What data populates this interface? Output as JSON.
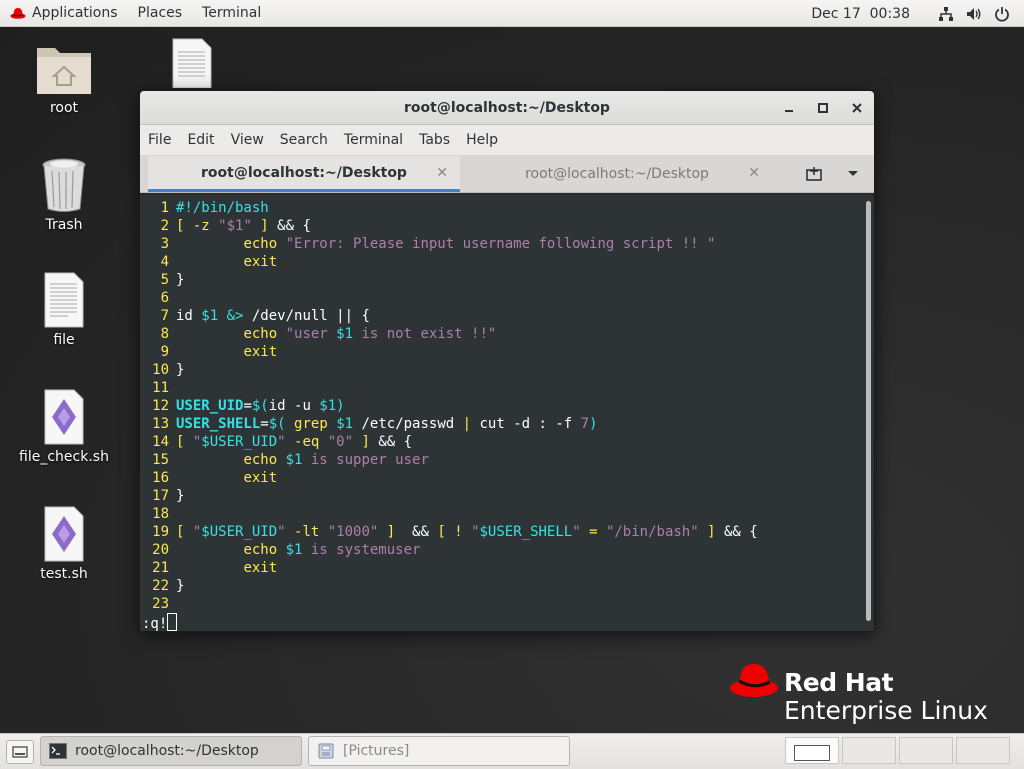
{
  "topbar": {
    "applications": "Applications",
    "places": "Places",
    "terminal": "Terminal",
    "clock": "Dec 17  00:38",
    "icons": [
      "network-icon",
      "volume-icon",
      "power-icon"
    ]
  },
  "desktop_icons": [
    {
      "label": "root",
      "icon": "home-folder-icon"
    },
    {
      "label": "Trash",
      "icon": "trash-icon"
    },
    {
      "label": "file",
      "icon": "text-file-icon"
    },
    {
      "label": "file_check.sh",
      "icon": "script-file-icon"
    },
    {
      "label": "test.sh",
      "icon": "script-file-icon"
    }
  ],
  "window": {
    "title": "root@localhost:~/Desktop",
    "menu": [
      "File",
      "Edit",
      "View",
      "Search",
      "Terminal",
      "Tabs",
      "Help"
    ],
    "tabs": [
      {
        "label": "root@localhost:~/Desktop",
        "active": true
      },
      {
        "label": "root@localhost:~/Desktop",
        "active": false
      }
    ],
    "command_line": ":q!"
  },
  "code_lines": [
    {
      "n": "1",
      "segs": [
        {
          "t": "#!/bin/bash",
          "c": "c"
        }
      ]
    },
    {
      "n": "2",
      "segs": [
        {
          "t": "[ -z ",
          "c": "y"
        },
        {
          "t": "\"$1\"",
          "c": "p"
        },
        {
          "t": " ] ",
          "c": "y"
        },
        {
          "t": "&& {",
          "c": "w"
        }
      ]
    },
    {
      "n": "3",
      "segs": [
        {
          "t": "        ",
          "c": "w"
        },
        {
          "t": "echo",
          "c": "y"
        },
        {
          "t": " \"Error: Please input username following script !! \"",
          "c": "p"
        }
      ]
    },
    {
      "n": "4",
      "segs": [
        {
          "t": "        ",
          "c": "w"
        },
        {
          "t": "exit",
          "c": "y"
        }
      ]
    },
    {
      "n": "5",
      "segs": [
        {
          "t": "}",
          "c": "w"
        }
      ]
    },
    {
      "n": "6",
      "segs": []
    },
    {
      "n": "7",
      "segs": [
        {
          "t": "id ",
          "c": "w"
        },
        {
          "t": "$1",
          "c": "c"
        },
        {
          "t": " ",
          "c": "w"
        },
        {
          "t": "&>",
          "c": "c"
        },
        {
          "t": " /dev/null || {",
          "c": "w"
        }
      ]
    },
    {
      "n": "8",
      "segs": [
        {
          "t": "        ",
          "c": "w"
        },
        {
          "t": "echo",
          "c": "y"
        },
        {
          "t": " \"user ",
          "c": "p"
        },
        {
          "t": "$1",
          "c": "c"
        },
        {
          "t": " is not exist !!\"",
          "c": "p"
        }
      ]
    },
    {
      "n": "9",
      "segs": [
        {
          "t": "        ",
          "c": "w"
        },
        {
          "t": "exit",
          "c": "y"
        }
      ]
    },
    {
      "n": "10",
      "segs": [
        {
          "t": "}",
          "c": "w"
        }
      ]
    },
    {
      "n": "11",
      "segs": []
    },
    {
      "n": "12",
      "segs": [
        {
          "t": "USER_UID",
          "c": "bc"
        },
        {
          "t": "=",
          "c": "w"
        },
        {
          "t": "$(",
          "c": "c"
        },
        {
          "t": "id -u ",
          "c": "w"
        },
        {
          "t": "$1",
          "c": "c"
        },
        {
          "t": ")",
          "c": "c"
        }
      ]
    },
    {
      "n": "13",
      "segs": [
        {
          "t": "USER_SHELL",
          "c": "bc"
        },
        {
          "t": "=",
          "c": "w"
        },
        {
          "t": "$( ",
          "c": "c"
        },
        {
          "t": "grep ",
          "c": "y"
        },
        {
          "t": "$1",
          "c": "c"
        },
        {
          "t": " /etc/passwd ",
          "c": "w"
        },
        {
          "t": "|",
          "c": "y"
        },
        {
          "t": " cut -d : -f ",
          "c": "w"
        },
        {
          "t": "7",
          "c": "p"
        },
        {
          "t": ")",
          "c": "c"
        }
      ]
    },
    {
      "n": "14",
      "segs": [
        {
          "t": "[ ",
          "c": "y"
        },
        {
          "t": "\"",
          "c": "p"
        },
        {
          "t": "$USER_UID",
          "c": "c"
        },
        {
          "t": "\"",
          "c": "p"
        },
        {
          "t": " -eq ",
          "c": "y"
        },
        {
          "t": "\"0\"",
          "c": "p"
        },
        {
          "t": " ] ",
          "c": "y"
        },
        {
          "t": "&& {",
          "c": "w"
        }
      ]
    },
    {
      "n": "15",
      "segs": [
        {
          "t": "        ",
          "c": "w"
        },
        {
          "t": "echo",
          "c": "y"
        },
        {
          "t": " ",
          "c": "w"
        },
        {
          "t": "$1",
          "c": "c"
        },
        {
          "t": " is supper user",
          "c": "p"
        }
      ]
    },
    {
      "n": "16",
      "segs": [
        {
          "t": "        ",
          "c": "w"
        },
        {
          "t": "exit",
          "c": "y"
        }
      ]
    },
    {
      "n": "17",
      "segs": [
        {
          "t": "}",
          "c": "w"
        }
      ]
    },
    {
      "n": "18",
      "segs": []
    },
    {
      "n": "19",
      "segs": [
        {
          "t": "[ ",
          "c": "y"
        },
        {
          "t": "\"",
          "c": "p"
        },
        {
          "t": "$USER_UID",
          "c": "c"
        },
        {
          "t": "\"",
          "c": "p"
        },
        {
          "t": " -lt ",
          "c": "y"
        },
        {
          "t": "\"1000\"",
          "c": "p"
        },
        {
          "t": " ]  ",
          "c": "y"
        },
        {
          "t": "&& ",
          "c": "w"
        },
        {
          "t": "[ ! ",
          "c": "y"
        },
        {
          "t": "\"",
          "c": "p"
        },
        {
          "t": "$USER_SHELL",
          "c": "c"
        },
        {
          "t": "\"",
          "c": "p"
        },
        {
          "t": " = ",
          "c": "y"
        },
        {
          "t": "\"/bin/bash\"",
          "c": "p"
        },
        {
          "t": " ] ",
          "c": "y"
        },
        {
          "t": "&& {",
          "c": "w"
        }
      ]
    },
    {
      "n": "20",
      "segs": [
        {
          "t": "        ",
          "c": "w"
        },
        {
          "t": "echo",
          "c": "y"
        },
        {
          "t": " ",
          "c": "w"
        },
        {
          "t": "$1",
          "c": "c"
        },
        {
          "t": " is systemuser",
          "c": "p"
        }
      ]
    },
    {
      "n": "21",
      "segs": [
        {
          "t": "        ",
          "c": "w"
        },
        {
          "t": "exit",
          "c": "y"
        }
      ]
    },
    {
      "n": "22",
      "segs": [
        {
          "t": "}",
          "c": "w"
        }
      ]
    },
    {
      "n": "23",
      "segs": []
    }
  ],
  "brand": {
    "line1": "Red Hat",
    "line2": "Enterprise Linux",
    "accent": "#ee0000"
  },
  "taskbar": {
    "items": [
      {
        "label": "root@localhost:~/Desktop",
        "icon": "terminal-icon",
        "active": true
      },
      {
        "label": "[Pictures]",
        "icon": "file-manager-icon",
        "active": false
      }
    ],
    "workspaces": 4
  },
  "colors": {
    "terminal_bg": "#2e3436",
    "keyword_yellow": "#fce94f",
    "cyan": "#34e2e2",
    "string_purple": "#ad7fa8",
    "tab_underline": "#3584e4"
  }
}
